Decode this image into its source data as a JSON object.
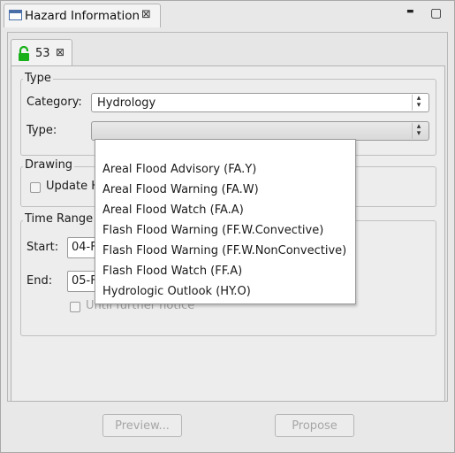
{
  "view": {
    "title": "Hazard Information",
    "close_glyph": "⊠",
    "minimize_glyph": "▬",
    "maximize_glyph": "▢"
  },
  "tab": {
    "label": "53",
    "close_glyph": "⊠",
    "lock_icon": "unlocked-padlock-icon",
    "lock_color": "#19b019"
  },
  "type_group": {
    "legend": "Type",
    "category_label": "Category:",
    "category_value": "Hydrology",
    "type_label": "Type:",
    "type_value": ""
  },
  "drawing_group": {
    "legend": "Drawing",
    "update_label": "Update H"
  },
  "time_group": {
    "legend": "Time Range",
    "start_label": "Start:",
    "start_value": "04-F",
    "end_label": "End:",
    "end_value": "05-F",
    "until_label": "Until further notice"
  },
  "type_dropdown": {
    "options": [
      "Areal Flood Advisory (FA.Y)",
      "Areal Flood Warning (FA.W)",
      "Areal Flood Watch (FA.A)",
      "Flash Flood Warning (FF.W.Convective)",
      "Flash Flood Warning (FF.W.NonConvective)",
      "Flash Flood Watch (FF.A)",
      "Hydrologic Outlook (HY.O)"
    ]
  },
  "buttons": {
    "preview": "Preview...",
    "propose": "Propose"
  }
}
